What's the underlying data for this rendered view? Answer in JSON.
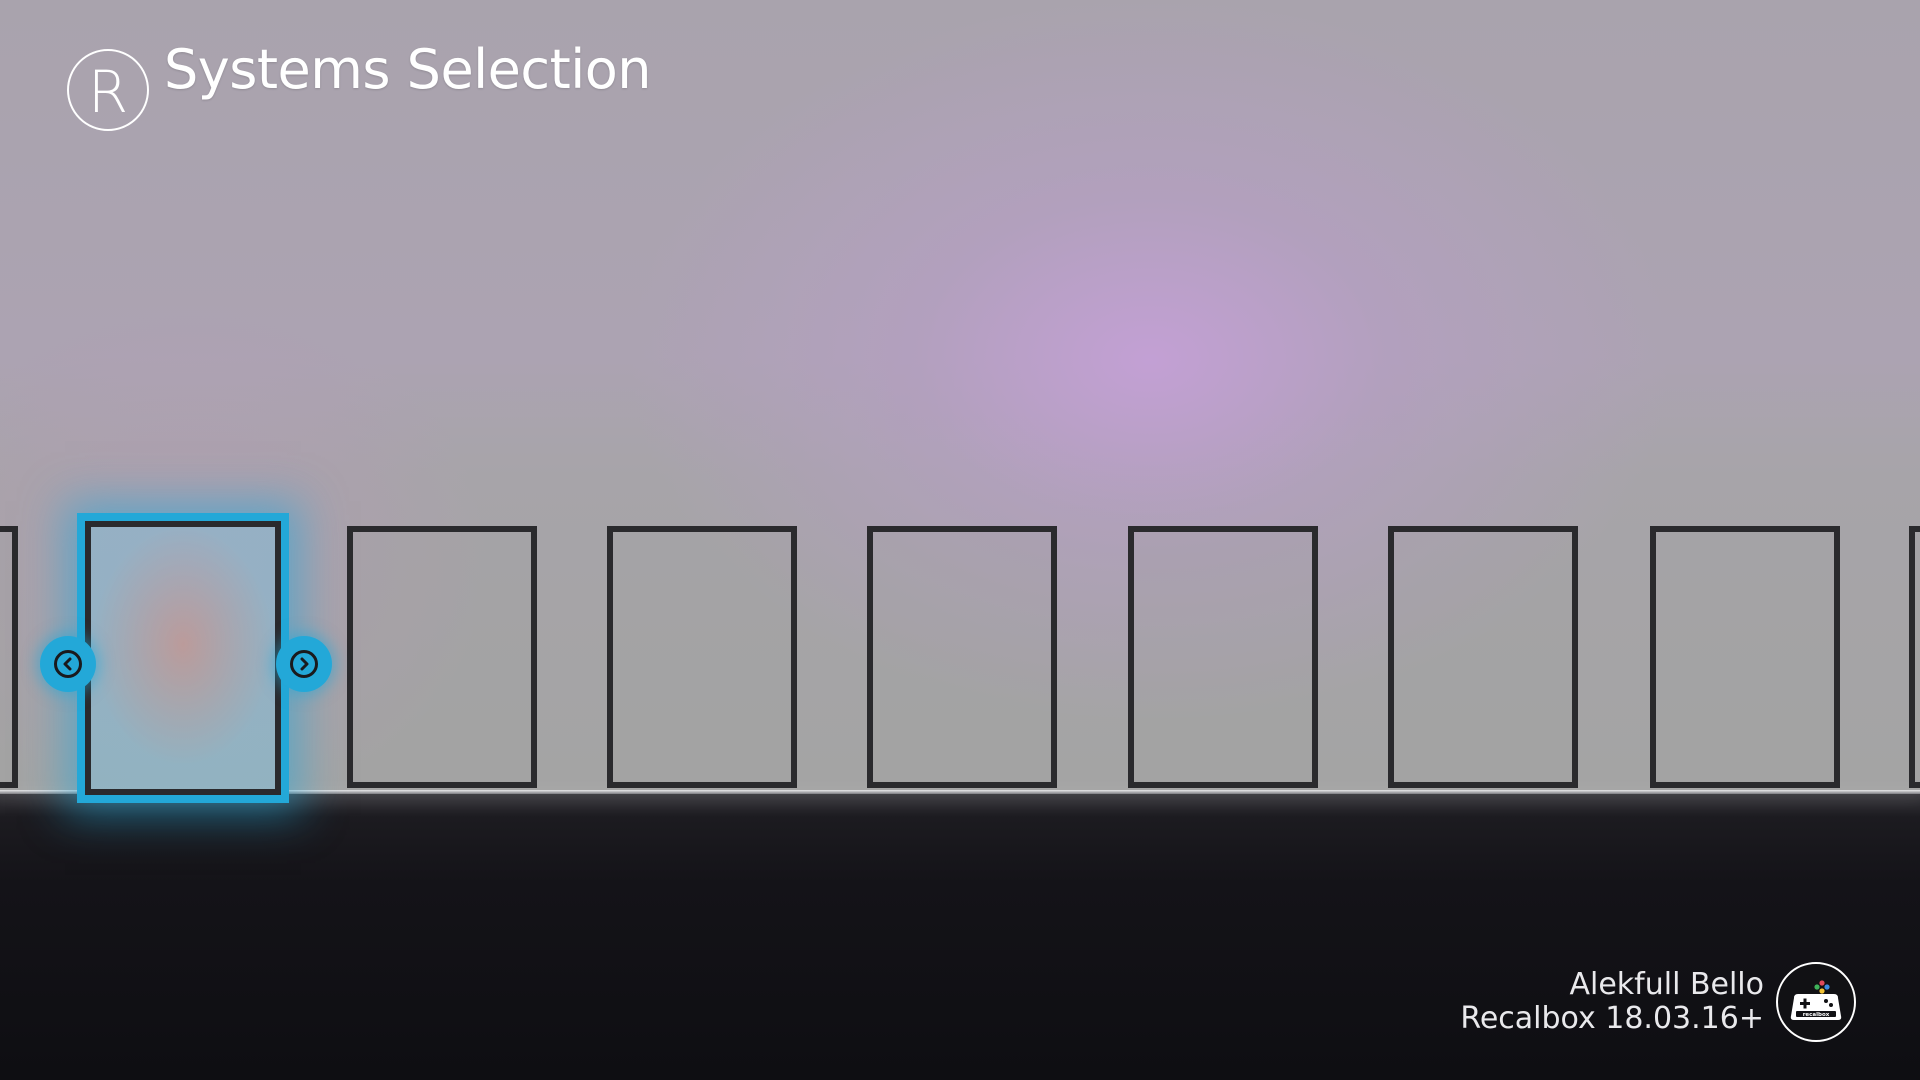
{
  "header": {
    "logo_letter": "R",
    "title": "Systems Selection"
  },
  "carousel": {
    "selected_index": 0,
    "tile_count_visible": 7,
    "accent_color": "#23a8d8",
    "tile_border_color": "#2a2a2d"
  },
  "footer": {
    "theme_name": "Alekfull Bello",
    "version": "Recalbox 18.03.16+",
    "logo_icon": "recalbox-gamepad-icon"
  }
}
